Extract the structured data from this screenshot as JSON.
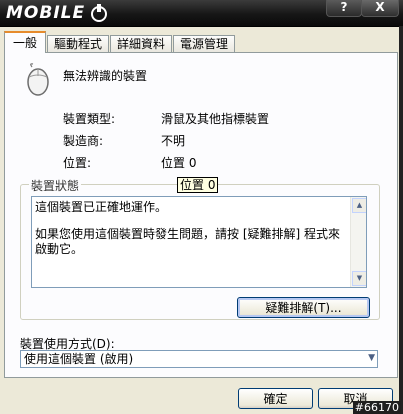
{
  "window": {
    "logo_text": "MOBILE",
    "help_button": "?",
    "close_button": "X"
  },
  "tabs": [
    {
      "label": "一般",
      "active": true
    },
    {
      "label": "驅動程式",
      "active": false
    },
    {
      "label": "詳細資料",
      "active": false
    },
    {
      "label": "電源管理",
      "active": false
    }
  ],
  "device": {
    "icon": "mouse-icon",
    "name": "無法辨識的裝置"
  },
  "properties": {
    "type_label": "裝置類型:",
    "type_value": "滑鼠及其他指標裝置",
    "manufacturer_label": "製造商:",
    "manufacturer_value": "不明",
    "location_label": "位置:",
    "location_value": "位置 0"
  },
  "tooltip": {
    "text": "位置 0"
  },
  "status": {
    "group_label": "裝置狀態",
    "line1": "這個裝置已正確地運作。",
    "line2": "如果您使用這個裝置時發生問題，請按 [疑難排解] 程式來啟動它。",
    "troubleshoot_button": "疑難排解(T)..."
  },
  "usage": {
    "label": "裝置使用方式(D):",
    "selected": "使用這個裝置 (啟用)"
  },
  "footer": {
    "ok_button": "確定",
    "cancel_button": "取消",
    "watermark": "#66170"
  }
}
